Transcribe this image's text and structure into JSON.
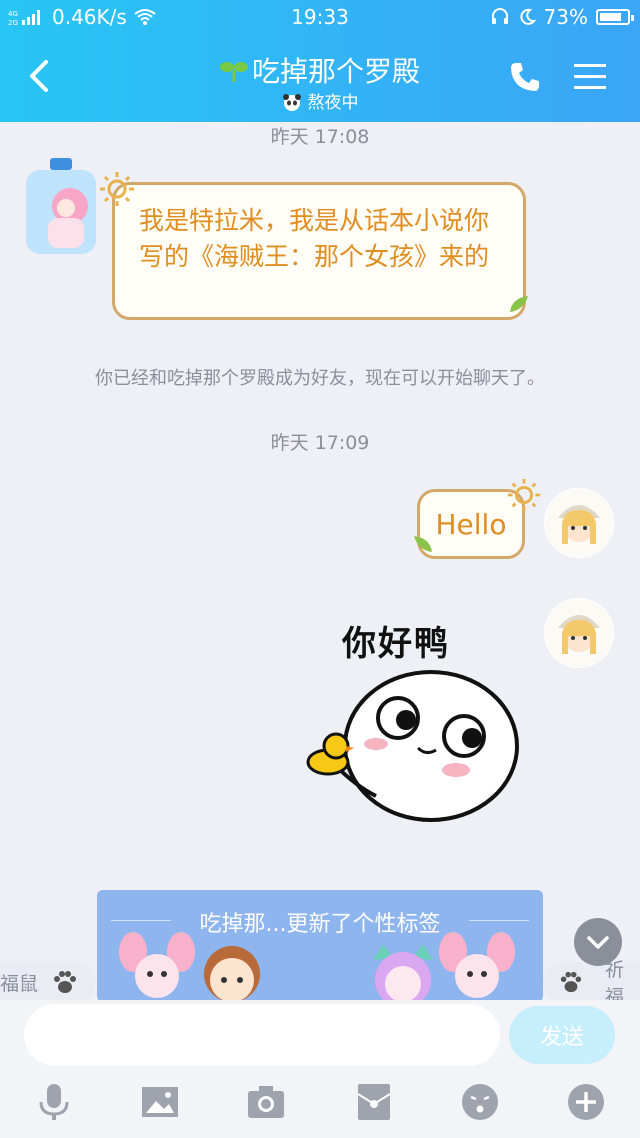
{
  "status_bar": {
    "network": "0.46K/s",
    "time": "19:33",
    "battery": "73%"
  },
  "header": {
    "title": "吃掉那个罗殿",
    "status": "熬夜中"
  },
  "messages": {
    "time1": "昨天 17:08",
    "bubble1": "我是特拉米，我是从话本小说你写的《海贼王：那个女孩》来的",
    "system": "你已经和吃掉那个罗殿成为好友，现在可以开始聊天了。",
    "time2": "昨天 17:09",
    "bubble2": "Hello",
    "sticker_text": "你好鸭"
  },
  "banner": {
    "title": "吃掉那...更新了个性标签",
    "left_tag": "福鼠",
    "right_tag": "祈福"
  },
  "input": {
    "send_label": "发送"
  },
  "colors": {
    "header": "#33b3f7",
    "bubble_border": "#d3a96a",
    "bubble_text": "#e08d22",
    "background": "#eef0f5"
  }
}
